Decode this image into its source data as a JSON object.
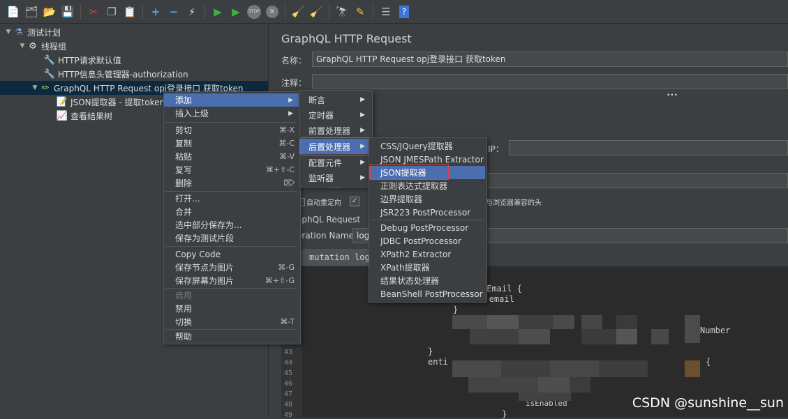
{
  "toolbar": {
    "icons": [
      "new-icon",
      "templates-icon",
      "open-icon",
      "save-icon",
      "cut-icon",
      "copy-icon",
      "paste-icon",
      "expand-icon",
      "collapse-icon",
      "toggle-icon",
      "start-icon",
      "start-no-pause-icon",
      "stop-icon",
      "shutdown-icon",
      "clear-icon",
      "clear-all-icon",
      "search-icon",
      "reset-search-icon",
      "function-helper-icon",
      "help-icon"
    ],
    "stop_label": "STOP"
  },
  "tree": [
    {
      "label": "测试计划",
      "icon": "test-plan-icon",
      "level": 0,
      "expanded": true
    },
    {
      "label": "线程组",
      "icon": "gear-icon",
      "level": 1,
      "expanded": true
    },
    {
      "label": "HTTP请求默认值",
      "icon": "wrench-icon",
      "level": 2
    },
    {
      "label": "HTTP信息头管理器-authorization",
      "icon": "wrench-icon",
      "level": 2
    },
    {
      "label": "GraphQL HTTP Request opj登录接口 获取token",
      "icon": "pen-icon",
      "level": 2,
      "expanded": true,
      "selected": true
    },
    {
      "label": "JSON提取器 - 提取token",
      "icon": "file-icon",
      "level": 3
    },
    {
      "label": "查看结果树",
      "icon": "chart-icon",
      "level": 3
    }
  ],
  "panel": {
    "title": "GraphQL HTTP Request",
    "name_label": "名称：",
    "name_value": "GraphQL HTTP Request opj登录接口 获取token",
    "comment_label": "注释：",
    "ip_label": "IP：",
    "auto_redirect": "自动重定向",
    "compat_headers": "与浏览器兼容的头",
    "gql_section": "aphQL Request",
    "operation_name_label": "eration Name",
    "operation_name_value": "logi",
    "query_tab": "mutation log",
    "dots": "•••"
  },
  "editor": {
    "line_numbers": [
      "43",
      "44",
      "45",
      "46",
      "47",
      "48",
      "49"
    ],
    "code": [
      "nEmail {",
      "id email",
      "}",
      "Number",
      "}",
      "enti",
      "{",
      "isEnabled",
      "}"
    ]
  },
  "context_menu": {
    "items": [
      {
        "label": "添加",
        "submenu": true,
        "highlighted": true
      },
      {
        "label": "插入上级",
        "submenu": true
      },
      {
        "sep": true
      },
      {
        "label": "剪切",
        "shortcut": "⌘-X"
      },
      {
        "label": "复制",
        "shortcut": "⌘-C"
      },
      {
        "label": "粘贴",
        "shortcut": "⌘-V"
      },
      {
        "label": "复写",
        "shortcut": "⌘+⇧-C"
      },
      {
        "label": "删除",
        "shortcut": "⌦"
      },
      {
        "sep": true
      },
      {
        "label": "打开..."
      },
      {
        "label": "合并"
      },
      {
        "label": "选中部分保存为..."
      },
      {
        "label": "保存为测试片段"
      },
      {
        "sep": true
      },
      {
        "label": "Copy Code"
      },
      {
        "label": "保存节点为图片",
        "shortcut": "⌘-G"
      },
      {
        "label": "保存屏幕为图片",
        "shortcut": "⌘+⇧-G"
      },
      {
        "sep": true
      },
      {
        "label": "启用",
        "disabled": true
      },
      {
        "label": "禁用"
      },
      {
        "label": "切换",
        "shortcut": "⌘-T"
      },
      {
        "sep": true
      },
      {
        "label": "帮助"
      }
    ]
  },
  "add_menu": {
    "items": [
      {
        "label": "断言",
        "submenu": true
      },
      {
        "label": "定时器",
        "submenu": true
      },
      {
        "label": "前置处理器",
        "submenu": true
      },
      {
        "label": "后置处理器",
        "submenu": true,
        "highlighted": true
      },
      {
        "label": "配置元件",
        "submenu": true
      },
      {
        "label": "监听器",
        "submenu": true
      }
    ]
  },
  "post_menu": {
    "items": [
      {
        "label": "CSS/JQuery提取器"
      },
      {
        "label": "JSON JMESPath Extractor"
      },
      {
        "label": "JSON提取器",
        "highlighted": true
      },
      {
        "label": "正则表达式提取器"
      },
      {
        "label": "边界提取器"
      },
      {
        "label": "JSR223 PostProcessor"
      },
      {
        "sep": true
      },
      {
        "label": "Debug PostProcessor"
      },
      {
        "label": "JDBC PostProcessor"
      },
      {
        "label": "XPath2 Extractor"
      },
      {
        "label": "XPath提取器"
      },
      {
        "label": "结果状态处理器"
      },
      {
        "label": "BeanShell PostProcessor"
      }
    ]
  },
  "watermark": "CSDN @sunshine__sun",
  "colors": {
    "highlight": "#4b6eaf",
    "selection": "#0d293e",
    "red_box": "#e0443a"
  }
}
